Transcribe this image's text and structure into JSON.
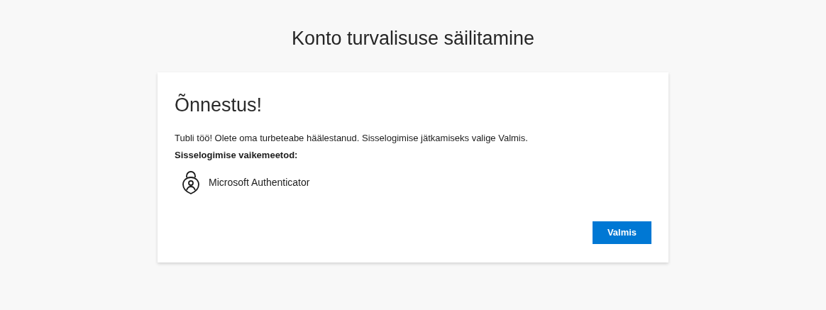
{
  "page_title": "Konto turvalisuse säilitamine",
  "card": {
    "heading": "Õnnestus!",
    "message": "Tubli töö! Olete oma turbeteabe häälestanud. Sisselogimise jätkamiseks valige Valmis.",
    "methods_label": "Sisselogimise vaikemeetod:",
    "methods": [
      {
        "name": "Microsoft Authenticator"
      }
    ],
    "button": "Valmis"
  }
}
